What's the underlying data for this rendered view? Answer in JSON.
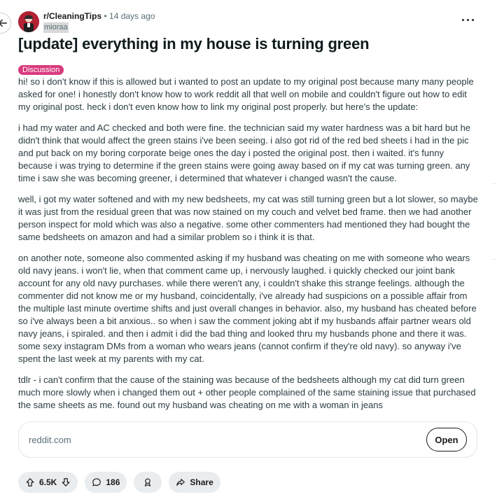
{
  "post": {
    "subreddit": "r/CleaningTips",
    "separator": "•",
    "age": "14 days ago",
    "author": "mioraa",
    "title": "[update] everything in my house is turning green",
    "flair": "Discussion",
    "paragraphs": [
      "hi! so i don't know if this is allowed but i wanted to post an update to my original post because many many people asked for one! i honestly don't know how to work reddit all that well on mobile and couldn't figure out how to edit my original post. heck i don't even know how to link my original post properly. but here's the update:",
      "i had my water and AC checked and both were fine. the technician said my water hardness was a bit hard but he didn't think that would affect the green stains i've been seeing. i also got rid of the red bed sheets i had in the pic and put back on my boring corporate beige ones the day i posted the original post. then i waited. it's funny because i was trying to determine if the green stains were going away based on if my cat was turning green. any time i saw she was becoming greener, i determined that whatever i changed wasn't the cause.",
      "well, i got my water softened and with my new bedsheets, my cat was still turning green but a lot slower, so maybe it was just from the residual green that was now stained on my couch and velvet bed frame. then we had another person inspect for mold which was also a negative. some other commenters had mentioned they had bought the same bedsheets on amazon and had a similar problem so i think it is that.",
      "on another note, someone also commented asking if my husband was cheating on me with someone who wears old navy jeans. i won't lie, when that comment came up, i nervously laughed. i quickly checked our joint bank account for any old navy purchases. while there weren't any, i couldn't shake this strange feelings. although the commenter did not know me or my husband, coincidentally, i've already had suspicions on a possible affair from the multiple last minute overtime shifts and just overall changes in behavior. also, my husband has cheated before so i've always been a bit anxious.. so when i saw the comment joking abt if my husbands affair partner wears old navy jeans, i spiraled. and then i admit i did the bad thing and looked thru my husbands phone and there it was. some sexy instagram DMs from a woman who wears jeans (cannot confirm if they're old navy). so anyway i've spent the last week at my parents with my cat.",
      "tdlr - i can't confirm that the cause of the staining was because of the bedsheets although my cat did turn green much more slowly when i changed them out + other people complained of the same staining issue that purchased the same sheets as me. found out my husband was cheating on me with a woman in jeans"
    ]
  },
  "link_card": {
    "url": "reddit.com",
    "open_label": "Open"
  },
  "actions": {
    "score": "6.5K",
    "comments": "186",
    "share_label": "Share"
  },
  "icons": {
    "back": "arrow-left-icon",
    "more": "more-horizontal-icon",
    "upvote": "upvote-arrow-icon",
    "downvote": "downvote-arrow-icon",
    "comment": "comment-bubble-icon",
    "award": "award-icon",
    "share": "share-arrow-icon"
  },
  "colors": {
    "flair_bg": "#d93a7d",
    "avatar_bg": "#b22234",
    "pill_bg": "#eaedef",
    "text": "#2a3c42"
  }
}
